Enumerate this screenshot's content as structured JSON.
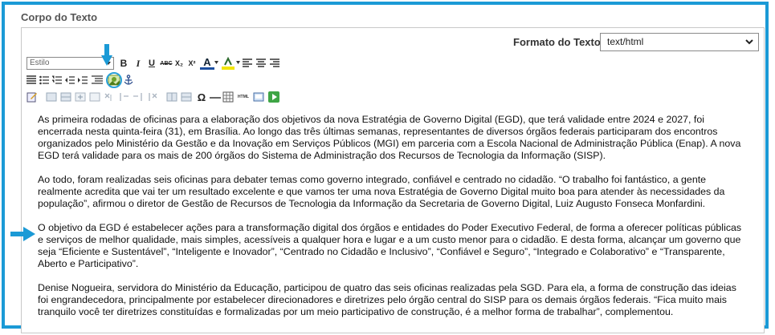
{
  "section": {
    "title": "Corpo do Texto"
  },
  "format": {
    "label": "Formato do Texto",
    "selected": "text/html"
  },
  "toolbar": {
    "style_placeholder": "Estilo",
    "bold": "B",
    "italic": "I",
    "underline": "U",
    "strike": "ABC",
    "subscript": "X₂",
    "superscript": "X²",
    "font_color": "A",
    "omega": "Ω",
    "html": "HTML"
  },
  "colors": {
    "highlight": "#1b9ad6",
    "arrow": "#1b9ad6"
  },
  "content": {
    "paragraphs": [
      "As primeira rodadas de oficinas para a elaboração dos objetivos da nova Estratégia de Governo Digital (EGD), que terá validade entre 2024 e 2027, foi encerrada nesta quinta-feira (31), em Brasília. Ao longo das três últimas semanas, representantes de diversos órgãos federais participaram dos encontros organizados pelo Ministério da Gestão e da Inovação em Serviços Públicos (MGI) em parceria com a Escola Nacional de Administração Pública (Enap). A nova EGD terá validade para os mais de 200 órgãos do Sistema de Administração dos Recursos de Tecnologia da Informação (SISP).",
      "Ao todo, foram realizadas seis oficinas para debater temas como governo integrado, confiável e centrado no cidadão. “O trabalho foi fantástico, a gente realmente acredita que vai ter um resultado excelente e que vamos ter uma nova Estratégia de Governo Digital muito boa para atender às necessidades da população”, afirmou o diretor de Gestão de Recursos de Tecnologia da Informação da Secretaria de Governo Digital, Luiz Augusto Fonseca Monfardini.",
      "O objetivo da EGD é estabelecer ações para a transformação digital dos órgãos e entidades do Poder Executivo Federal, de forma a oferecer políticas públicas e serviços de melhor qualidade, mais simples, acessíveis a qualquer hora e lugar e a um custo menor para o cidadão. E desta forma, alcançar um governo que seja “Eficiente e Sustentável”, “Inteligente e Inovador”, “Centrado no Cidadão e Inclusivo”, “Confiável e Seguro”, “Integrado e Colaborativo” e “Transparente, Aberto e Participativo”.",
      "Denise Nogueira, servidora do Ministério da Educação, participou de quatro das seis oficinas realizadas pela SGD. Para ela, a forma de construção das ideias foi engrandecedora, principalmente por estabelecer direcionadores e diretrizes pelo órgão central do SISP para os demais órgãos federais.  “Fica muito mais tranquilo você ter diretrizes constituídas e formalizadas por um meio participativo de construção, é a melhor forma de trabalhar”, complementou."
    ]
  }
}
